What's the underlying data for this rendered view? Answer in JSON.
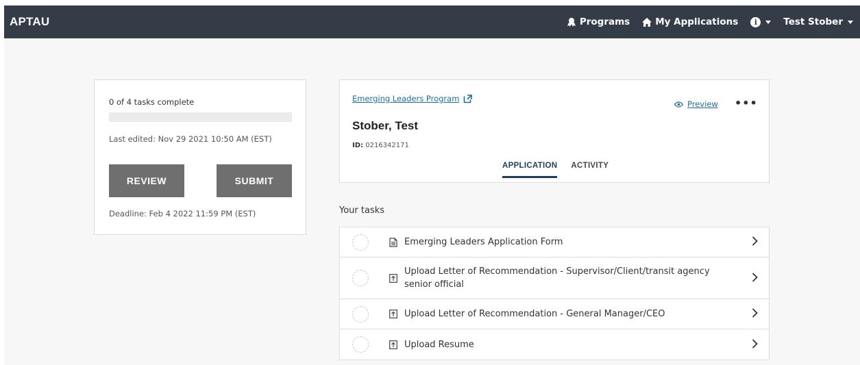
{
  "header": {
    "brand": "APTAU",
    "nav": {
      "programs": "Programs",
      "my_applications": "My Applications",
      "user": "Test Stober"
    }
  },
  "status": {
    "tasks_complete": "0 of 4 tasks complete",
    "progress_fraction": 0,
    "last_edited": "Last edited: Nov 29 2021 10:50 AM (EST)",
    "review_label": "REVIEW",
    "submit_label": "SUBMIT",
    "deadline": "Deadline: Feb 4 2022 11:59 PM (EST)"
  },
  "application": {
    "program_link": "Emerging Leaders Program",
    "preview_label": "Preview",
    "more_label": "•••",
    "applicant_name": "Stober, Test",
    "id_label": "ID:",
    "id_value": "0216342171",
    "tabs": [
      {
        "label": "APPLICATION"
      },
      {
        "label": "ACTIVITY"
      }
    ]
  },
  "tasks": {
    "heading": "Your tasks",
    "items": [
      {
        "label": "Emerging Leaders Application Form",
        "icon": "document-icon"
      },
      {
        "label": "Upload Letter of Recommendation - Supervisor/Client/transit agency senior official",
        "icon": "upload-icon"
      },
      {
        "label": "Upload Letter of Recommendation - General Manager/CEO",
        "icon": "upload-icon"
      },
      {
        "label": "Upload Resume",
        "icon": "upload-icon"
      }
    ]
  },
  "colors": {
    "topbar": "#343d47",
    "link": "#1f6e9c",
    "button": "#6f6f6f",
    "active_tab": "#1d3f5e"
  }
}
